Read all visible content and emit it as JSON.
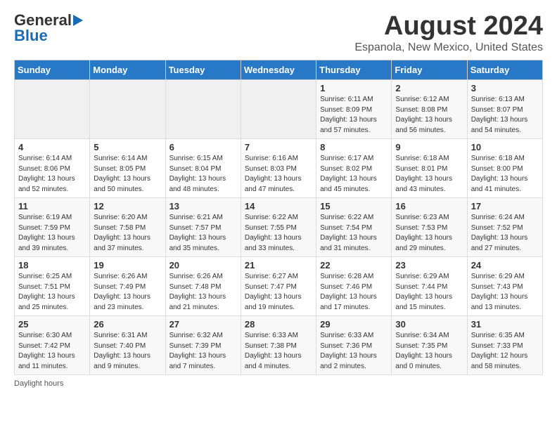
{
  "header": {
    "logo_line1": "General",
    "logo_line2": "Blue",
    "main_title": "August 2024",
    "subtitle": "Espanola, New Mexico, United States"
  },
  "days_of_week": [
    "Sunday",
    "Monday",
    "Tuesday",
    "Wednesday",
    "Thursday",
    "Friday",
    "Saturday"
  ],
  "footer": {
    "daylight_label": "Daylight hours"
  },
  "weeks": [
    [
      {
        "day": "",
        "info": ""
      },
      {
        "day": "",
        "info": ""
      },
      {
        "day": "",
        "info": ""
      },
      {
        "day": "",
        "info": ""
      },
      {
        "day": "1",
        "info": "Sunrise: 6:11 AM\nSunset: 8:09 PM\nDaylight: 13 hours\nand 57 minutes."
      },
      {
        "day": "2",
        "info": "Sunrise: 6:12 AM\nSunset: 8:08 PM\nDaylight: 13 hours\nand 56 minutes."
      },
      {
        "day": "3",
        "info": "Sunrise: 6:13 AM\nSunset: 8:07 PM\nDaylight: 13 hours\nand 54 minutes."
      }
    ],
    [
      {
        "day": "4",
        "info": "Sunrise: 6:14 AM\nSunset: 8:06 PM\nDaylight: 13 hours\nand 52 minutes."
      },
      {
        "day": "5",
        "info": "Sunrise: 6:14 AM\nSunset: 8:05 PM\nDaylight: 13 hours\nand 50 minutes."
      },
      {
        "day": "6",
        "info": "Sunrise: 6:15 AM\nSunset: 8:04 PM\nDaylight: 13 hours\nand 48 minutes."
      },
      {
        "day": "7",
        "info": "Sunrise: 6:16 AM\nSunset: 8:03 PM\nDaylight: 13 hours\nand 47 minutes."
      },
      {
        "day": "8",
        "info": "Sunrise: 6:17 AM\nSunset: 8:02 PM\nDaylight: 13 hours\nand 45 minutes."
      },
      {
        "day": "9",
        "info": "Sunrise: 6:18 AM\nSunset: 8:01 PM\nDaylight: 13 hours\nand 43 minutes."
      },
      {
        "day": "10",
        "info": "Sunrise: 6:18 AM\nSunset: 8:00 PM\nDaylight: 13 hours\nand 41 minutes."
      }
    ],
    [
      {
        "day": "11",
        "info": "Sunrise: 6:19 AM\nSunset: 7:59 PM\nDaylight: 13 hours\nand 39 minutes."
      },
      {
        "day": "12",
        "info": "Sunrise: 6:20 AM\nSunset: 7:58 PM\nDaylight: 13 hours\nand 37 minutes."
      },
      {
        "day": "13",
        "info": "Sunrise: 6:21 AM\nSunset: 7:57 PM\nDaylight: 13 hours\nand 35 minutes."
      },
      {
        "day": "14",
        "info": "Sunrise: 6:22 AM\nSunset: 7:55 PM\nDaylight: 13 hours\nand 33 minutes."
      },
      {
        "day": "15",
        "info": "Sunrise: 6:22 AM\nSunset: 7:54 PM\nDaylight: 13 hours\nand 31 minutes."
      },
      {
        "day": "16",
        "info": "Sunrise: 6:23 AM\nSunset: 7:53 PM\nDaylight: 13 hours\nand 29 minutes."
      },
      {
        "day": "17",
        "info": "Sunrise: 6:24 AM\nSunset: 7:52 PM\nDaylight: 13 hours\nand 27 minutes."
      }
    ],
    [
      {
        "day": "18",
        "info": "Sunrise: 6:25 AM\nSunset: 7:51 PM\nDaylight: 13 hours\nand 25 minutes."
      },
      {
        "day": "19",
        "info": "Sunrise: 6:26 AM\nSunset: 7:49 PM\nDaylight: 13 hours\nand 23 minutes."
      },
      {
        "day": "20",
        "info": "Sunrise: 6:26 AM\nSunset: 7:48 PM\nDaylight: 13 hours\nand 21 minutes."
      },
      {
        "day": "21",
        "info": "Sunrise: 6:27 AM\nSunset: 7:47 PM\nDaylight: 13 hours\nand 19 minutes."
      },
      {
        "day": "22",
        "info": "Sunrise: 6:28 AM\nSunset: 7:46 PM\nDaylight: 13 hours\nand 17 minutes."
      },
      {
        "day": "23",
        "info": "Sunrise: 6:29 AM\nSunset: 7:44 PM\nDaylight: 13 hours\nand 15 minutes."
      },
      {
        "day": "24",
        "info": "Sunrise: 6:29 AM\nSunset: 7:43 PM\nDaylight: 13 hours\nand 13 minutes."
      }
    ],
    [
      {
        "day": "25",
        "info": "Sunrise: 6:30 AM\nSunset: 7:42 PM\nDaylight: 13 hours\nand 11 minutes."
      },
      {
        "day": "26",
        "info": "Sunrise: 6:31 AM\nSunset: 7:40 PM\nDaylight: 13 hours\nand 9 minutes."
      },
      {
        "day": "27",
        "info": "Sunrise: 6:32 AM\nSunset: 7:39 PM\nDaylight: 13 hours\nand 7 minutes."
      },
      {
        "day": "28",
        "info": "Sunrise: 6:33 AM\nSunset: 7:38 PM\nDaylight: 13 hours\nand 4 minutes."
      },
      {
        "day": "29",
        "info": "Sunrise: 6:33 AM\nSunset: 7:36 PM\nDaylight: 13 hours\nand 2 minutes."
      },
      {
        "day": "30",
        "info": "Sunrise: 6:34 AM\nSunset: 7:35 PM\nDaylight: 13 hours\nand 0 minutes."
      },
      {
        "day": "31",
        "info": "Sunrise: 6:35 AM\nSunset: 7:33 PM\nDaylight: 12 hours\nand 58 minutes."
      }
    ]
  ]
}
